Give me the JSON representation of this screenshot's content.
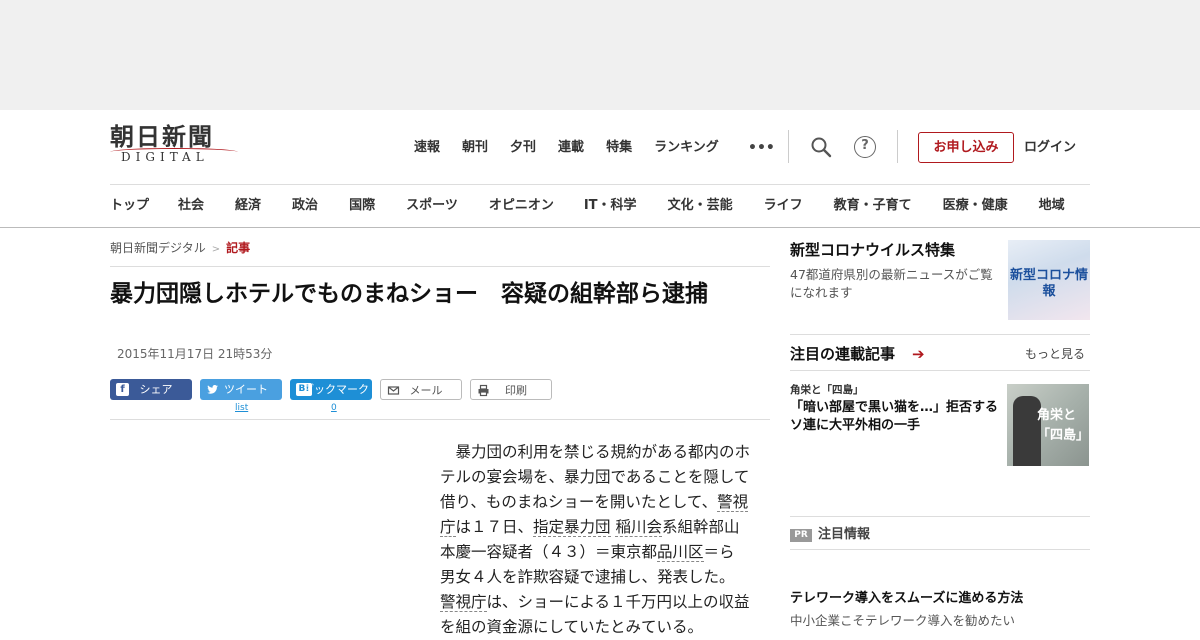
{
  "header": {
    "logo_main": "朝日新聞",
    "logo_sub": "DIGITAL",
    "top_nav": [
      "速報",
      "朝刊",
      "夕刊",
      "連載",
      "特集",
      "ランキング"
    ],
    "more_label": "•••",
    "help_label": "?",
    "apply_label": "お申し込み",
    "login_label": "ログイン",
    "categories": [
      "トップ",
      "社会",
      "経済",
      "政治",
      "国際",
      "スポーツ",
      "オピニオン",
      "IT・科学",
      "文化・芸能",
      "ライフ",
      "教育・子育て",
      "医療・健康",
      "地域"
    ]
  },
  "breadcrumb": {
    "home": "朝日新聞デジタル",
    "separator": ">",
    "current": "記事"
  },
  "article": {
    "title": "暴力団隠しホテルでものまねショー　容疑の組幹部ら逮捕",
    "date": "2015年11月17日 21時53分",
    "share": {
      "facebook": "シェア",
      "twitter": "ツイート",
      "twitter_count": "list",
      "hatena": "ブックマーク",
      "hatena_icon": "B!",
      "hatena_count": "0",
      "mail": "メール",
      "print": "印刷"
    },
    "body": {
      "t1": "暴力団の利用を禁じる規約がある都内のホテルの宴会場を、暴力団であることを隠して借り、ものまねショーを開いたとして、",
      "k1": "警視庁",
      "t2": "は１７日、",
      "k2": "指定暴力団",
      "t3": " ",
      "k3": "稲川会",
      "t4": "系組幹部山本慶一容疑者（４３）＝東京都",
      "k4": "品川区",
      "t5": "＝ら男女４人を詐欺容疑で逮捕し、発表した。",
      "k5": "警視庁",
      "t6": "は、ショーによる１千万円以上の収益を組の資金源にしていたとみている。"
    }
  },
  "sidebar": {
    "corona_title": "新型コロナウイルス特集",
    "corona_desc": "47都道府県別の最新ニュースがご覧になれます",
    "corona_img_text": "新型コロナ情報",
    "featured_title": "注目の連載記事",
    "featured_arrow": "➔",
    "more_label": "もっと見る",
    "featured_tag": "角栄と「四島」",
    "featured_text": "「暗い部屋で黒い猫を…」拒否するソ連に大平外相の一手",
    "featured_img_text": "角栄と「四島」",
    "pr_badge": "PR",
    "pr_title": "注目情報",
    "telework_title": "テレワーク導入をスムーズに進める方法",
    "telework_desc": "中小企業こそテレワーク導入を勧めたい"
  },
  "colors": {
    "accent": "#b0191e",
    "facebook": "#3b5a98",
    "twitter": "#4aa0e0",
    "hatena": "#1e8fd6"
  }
}
